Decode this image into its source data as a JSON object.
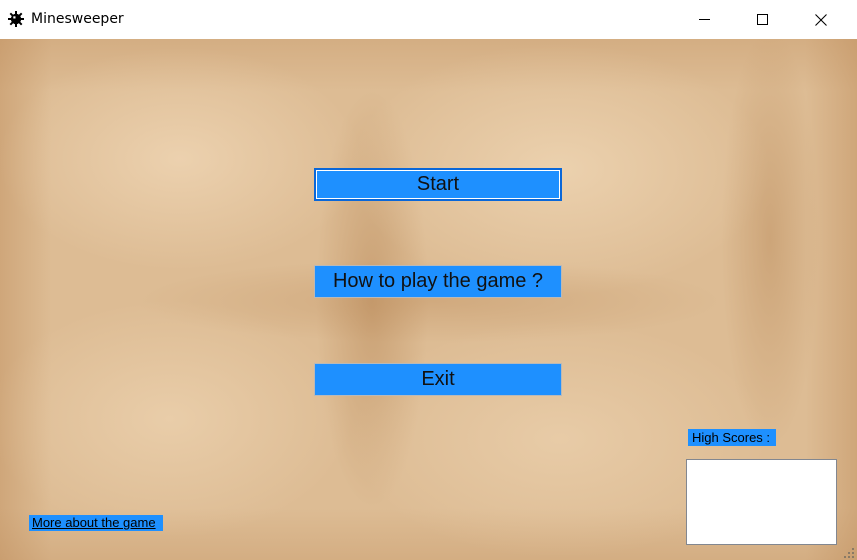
{
  "window": {
    "title": "Minesweeper",
    "icon": "mine-icon",
    "controls": {
      "minimize_icon": "minimize-icon",
      "maximize_icon": "maximize-icon",
      "close_icon": "close-icon"
    }
  },
  "menu": {
    "start_label": "Start",
    "howto_label": "How to play the game ?",
    "exit_label": "Exit"
  },
  "footer": {
    "more_link": "More about the game"
  },
  "high_scores": {
    "label": "High Scores :",
    "entries": []
  },
  "colors": {
    "button_fill": "#1e90ff",
    "background": "#ddbc94",
    "focus_border": "#0a67d8"
  }
}
